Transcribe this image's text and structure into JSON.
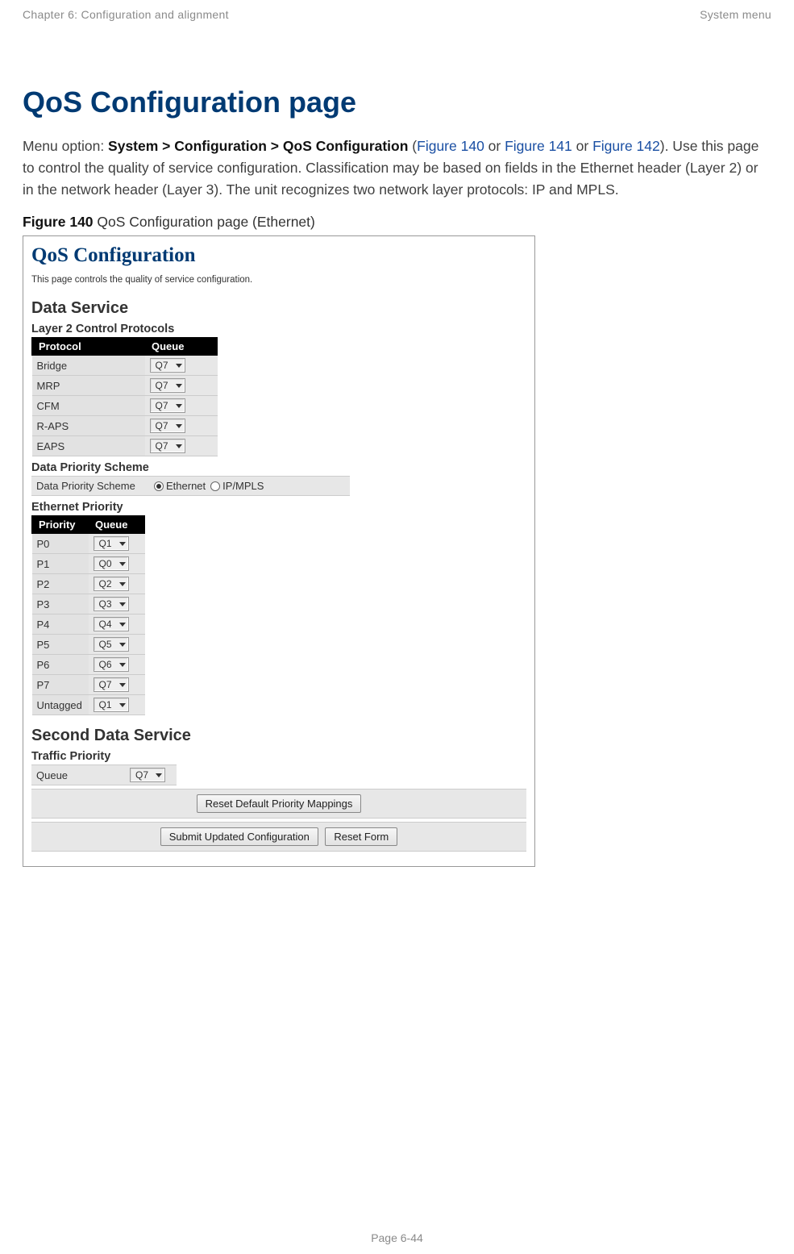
{
  "header": {
    "left": "Chapter 6:  Configuration and alignment",
    "right": "System menu"
  },
  "title": "QoS Configuration page",
  "intro": {
    "prefix": "Menu option: ",
    "menu_path": "System > Configuration > QoS Configuration",
    "open_paren": " (",
    "link1": "Figure 140",
    "or1": " or ",
    "link2": "Figure 141",
    "or2": " or ",
    "link3": "Figure 142",
    "after": "). Use this page to control the quality of service configuration. Classification may be based on fields in the Ethernet header (Layer 2) or in the network header (Layer 3). The unit recognizes two network layer protocols: IP and MPLS."
  },
  "figure_caption": {
    "label": "Figure 140",
    "text": "  QoS Configuration page (Ethernet)"
  },
  "qos": {
    "title": "QoS Configuration",
    "subtext": "This page controls the quality of service configuration.",
    "data_service_title": "Data Service",
    "l2cp_title": "Layer 2 Control Protocols",
    "l2cp_headers": {
      "protocol": "Protocol",
      "queue": "Queue"
    },
    "l2cp_rows": [
      {
        "protocol": "Bridge",
        "queue": "Q7"
      },
      {
        "protocol": "MRP",
        "queue": "Q7"
      },
      {
        "protocol": "CFM",
        "queue": "Q7"
      },
      {
        "protocol": "R-APS",
        "queue": "Q7"
      },
      {
        "protocol": "EAPS",
        "queue": "Q7"
      }
    ],
    "scheme_title": "Data Priority Scheme",
    "scheme_label": "Data Priority Scheme",
    "scheme_opt_ethernet": "Ethernet",
    "scheme_opt_ipmpls": "IP/MPLS",
    "ep_title": "Ethernet Priority",
    "ep_headers": {
      "priority": "Priority",
      "queue": "Queue"
    },
    "ep_rows": [
      {
        "priority": "P0",
        "queue": "Q1"
      },
      {
        "priority": "P1",
        "queue": "Q0"
      },
      {
        "priority": "P2",
        "queue": "Q2"
      },
      {
        "priority": "P3",
        "queue": "Q3"
      },
      {
        "priority": "P4",
        "queue": "Q4"
      },
      {
        "priority": "P5",
        "queue": "Q5"
      },
      {
        "priority": "P6",
        "queue": "Q6"
      },
      {
        "priority": "P7",
        "queue": "Q7"
      },
      {
        "priority": "Untagged",
        "queue": "Q1"
      }
    ],
    "second_service_title": "Second Data Service",
    "traffic_priority_title": "Traffic Priority",
    "tp_label": "Queue",
    "tp_value": "Q7",
    "btn_reset_defaults": "Reset Default Priority Mappings",
    "btn_submit": "Submit Updated Configuration",
    "btn_reset_form": "Reset Form"
  },
  "footer": "Page 6-44"
}
